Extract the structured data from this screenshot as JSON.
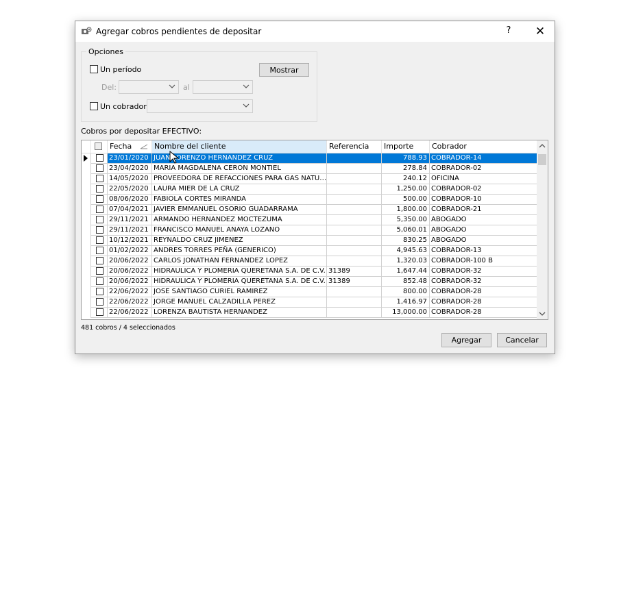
{
  "window": {
    "title": "Agregar cobros pendientes de depositar",
    "help": "?",
    "close": "✕"
  },
  "options": {
    "group_title": "Opciones",
    "period_label": "Un período",
    "from_label": "Del:",
    "to_label": "al",
    "collector_label": "Un cobrador",
    "show_button": "Mostrar"
  },
  "grid": {
    "section_label": "Cobros por depositar EFECTIVO:",
    "columns": [
      "",
      "Fecha",
      "Nombre del cliente",
      "Referencia",
      "Importe",
      "Cobrador"
    ],
    "rows": [
      {
        "fecha": "23/01/2020",
        "cliente": "JUAN LORENZO HERNANDEZ CRUZ",
        "ref": "",
        "importe": "788.93",
        "cobrador": "COBRADOR-14",
        "selected": true
      },
      {
        "fecha": "23/04/2020",
        "cliente": "MARIA MAGDALENA CERON MONTIEL",
        "ref": "",
        "importe": "278.84",
        "cobrador": "COBRADOR-02"
      },
      {
        "fecha": "14/05/2020",
        "cliente": "PROVEEDORA DE REFACCIONES PARA GAS NATU…",
        "ref": "",
        "importe": "240.12",
        "cobrador": "OFICINA"
      },
      {
        "fecha": "22/05/2020",
        "cliente": "LAURA MIER DE LA CRUZ",
        "ref": "",
        "importe": "1,250.00",
        "cobrador": "COBRADOR-02"
      },
      {
        "fecha": "08/06/2020",
        "cliente": "FABIOLA CORTES MIRANDA",
        "ref": "",
        "importe": "500.00",
        "cobrador": "COBRADOR-10"
      },
      {
        "fecha": "07/04/2021",
        "cliente": "JAVIER EMMANUEL OSORIO GUADARRAMA",
        "ref": "",
        "importe": "1,800.00",
        "cobrador": "COBRADOR-21"
      },
      {
        "fecha": "29/11/2021",
        "cliente": "ARMANDO HERNANDEZ MOCTEZUMA",
        "ref": "",
        "importe": "5,350.00",
        "cobrador": "ABOGADO"
      },
      {
        "fecha": "29/11/2021",
        "cliente": "FRANCISCO MANUEL ANAYA LOZANO",
        "ref": "",
        "importe": "5,060.01",
        "cobrador": "ABOGADO"
      },
      {
        "fecha": "10/12/2021",
        "cliente": "REYNALDO CRUZ JIMENEZ",
        "ref": "",
        "importe": "830.25",
        "cobrador": "ABOGADO"
      },
      {
        "fecha": "01/02/2022",
        "cliente": "ANDRES TORRES PEÑA    (GENERICO)",
        "ref": "",
        "importe": "4,945.63",
        "cobrador": "COBRADOR-13"
      },
      {
        "fecha": "20/06/2022",
        "cliente": "CARLOS JONATHAN FERNANDEZ LOPEZ",
        "ref": "",
        "importe": "1,320.03",
        "cobrador": "COBRADOR-100 B"
      },
      {
        "fecha": "20/06/2022",
        "cliente": "HIDRAULICA Y PLOMERIA QUERETANA S.A. DE C.V.",
        "ref": "31389",
        "importe": "1,647.44",
        "cobrador": "COBRADOR-32"
      },
      {
        "fecha": "20/06/2022",
        "cliente": "HIDRAULICA Y PLOMERIA QUERETANA S.A. DE C.V.",
        "ref": "31389",
        "importe": "852.48",
        "cobrador": "COBRADOR-32"
      },
      {
        "fecha": "22/06/2022",
        "cliente": "JOSE SANTIAGO CURIEL RAMIREZ",
        "ref": "",
        "importe": "800.00",
        "cobrador": "COBRADOR-28"
      },
      {
        "fecha": "22/06/2022",
        "cliente": "JORGE MANUEL CALZADILLA PEREZ",
        "ref": "",
        "importe": "1,416.97",
        "cobrador": "COBRADOR-28"
      },
      {
        "fecha": "22/06/2022",
        "cliente": "LORENZA BAUTISTA HERNANDEZ",
        "ref": "",
        "importe": "13,000.00",
        "cobrador": "COBRADOR-28"
      }
    ]
  },
  "status": "481 cobros / 4 seleccionados",
  "buttons": {
    "add": "Agregar",
    "cancel": "Cancelar"
  },
  "colors": {
    "selection": "#0078d7",
    "header_hover": "#d9ebf9",
    "dialog_bg": "#f0f0f0"
  }
}
